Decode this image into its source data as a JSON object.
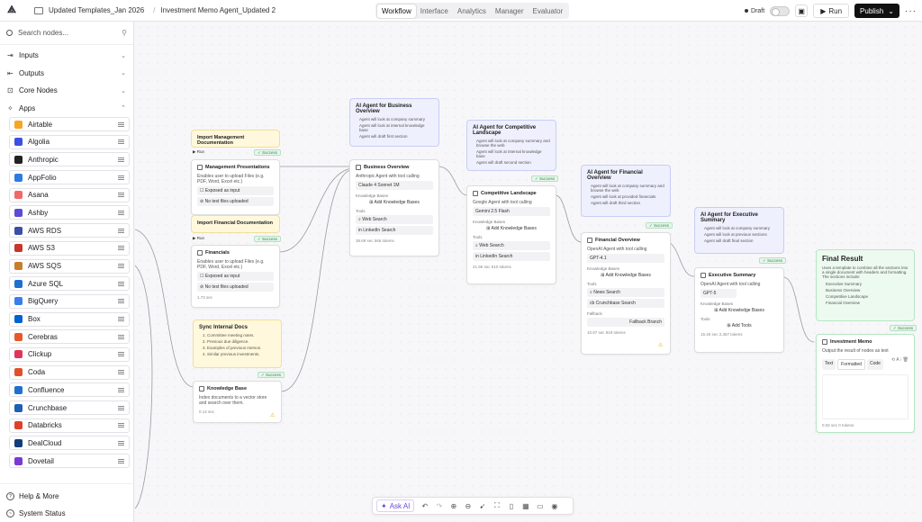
{
  "header": {
    "breadcrumb_1": "Updated Templates_Jan 2026",
    "breadcrumb_2": "Investment Memo Agent_Updated 2",
    "tabs": [
      "Workflow",
      "Interface",
      "Analytics",
      "Manager",
      "Evaluator"
    ],
    "active_tab": "Workflow",
    "draft_label": "Draft",
    "run_label": "Run",
    "publish_label": "Publish"
  },
  "sidebar": {
    "search_placeholder": "Search nodes...",
    "sections": [
      "Inputs",
      "Outputs",
      "Core Nodes",
      "Apps"
    ],
    "apps": [
      {
        "label": "Airtable",
        "color": "#f5a623"
      },
      {
        "label": "Algolia",
        "color": "#3c4fe0"
      },
      {
        "label": "Anthropic",
        "color": "#222222"
      },
      {
        "label": "AppFolio",
        "color": "#2d7be0"
      },
      {
        "label": "Asana",
        "color": "#f06a6a"
      },
      {
        "label": "Ashby",
        "color": "#5b4bd6"
      },
      {
        "label": "AWS RDS",
        "color": "#3b4ea8"
      },
      {
        "label": "AWS S3",
        "color": "#c7352b"
      },
      {
        "label": "AWS SQS",
        "color": "#c77d2b"
      },
      {
        "label": "Azure SQL",
        "color": "#1f6fd1"
      },
      {
        "label": "BigQuery",
        "color": "#3b7ded"
      },
      {
        "label": "Box",
        "color": "#0061d5"
      },
      {
        "label": "Cerebras",
        "color": "#e8572b"
      },
      {
        "label": "Clickup",
        "color": "#e0345a"
      },
      {
        "label": "Coda",
        "color": "#e0502b"
      },
      {
        "label": "Confluence",
        "color": "#1f6fd1"
      },
      {
        "label": "Crunchbase",
        "color": "#1f5fb6"
      },
      {
        "label": "Databricks",
        "color": "#e0402b"
      },
      {
        "label": "DealCloud",
        "color": "#123d7a"
      },
      {
        "label": "Dovetail",
        "color": "#7a3ad6"
      }
    ],
    "help_label": "Help & More",
    "status_label": "System Status"
  },
  "canvas": {
    "import_mgmt_title": "Import Management Documentation",
    "run_label": "Run",
    "success_label": "Success",
    "mgmt_node_title": "Management Presentations",
    "mgmt_node_desc": "Enables user to upload Files (e.g. PDF, Word, Excel etc.)",
    "exposed_input": "Exposed as input",
    "no_files": "No test files uploaded",
    "import_fin_title": "Import Financial Documentation",
    "fin_node_title": "Financials",
    "fin_node_desc": "Enables user to upload Files (e.g. PDF, Word, Excel etc.)",
    "fin_meta": "1.73 sec",
    "sync_title": "Sync Internal Docs",
    "sync_items": [
      "1.  Committee meeting notes.",
      "2.  Previous due diligence.",
      "3.  Examples of previous memos.",
      "4.  Similar previous investments."
    ],
    "kb_node_title": "Knowledge Base",
    "kb_node_desc": "Index documents to a vector store and search over them.",
    "kb_meta": "0.14 sec",
    "biz_sticky_title": "AI Agent for Business Overview",
    "biz_sticky_items": [
      "Agent will look at company summary",
      "Agent will look at internal knowledge base",
      "Agent will draft first section"
    ],
    "biz_node_title": "Business Overview",
    "biz_node_desc": "Anthropic Agent with tool calling",
    "biz_model": "Claude 4 Sonnet 1M",
    "kb_label": "Knowledge Bases",
    "add_kb": "Add Knowledge Bases",
    "tools_label": "Tools",
    "web_search": "Web Search",
    "linkedin_search": "LinkedIn Search",
    "biz_meta": "38.69 sec   566 tokens",
    "comp_sticky_title": "AI Agent for Competitive Landscape",
    "comp_sticky_items": [
      "Agent will look at company summary and browse the web",
      "Agent will look at internal knowledge base",
      "Agent will draft second section"
    ],
    "comp_node_title": "Competitive Landscape",
    "comp_node_desc": "Google Agent with tool calling",
    "comp_model": "Gemini 2.5 Flash",
    "comp_meta": "21.96 sec   510 tokens",
    "fin_sticky_title": "AI Agent for Financial Overview",
    "fin_sticky_items": [
      "Agent will look at company summary and browse the web",
      "Agent will look at provided financials",
      "Agent will draft third section"
    ],
    "finov_node_title": "Financial Overview",
    "finov_node_desc": "OpenAI Agent with tool calling",
    "finov_model": "GPT-4.1",
    "news_search": "News Search",
    "crunchbase_search": "Crunchbase Search",
    "fallback_label": "Fallback",
    "fallback_branch": "Fallback Branch",
    "finov_meta": "10.97 sec   819 tokens",
    "exec_sticky_title": "AI Agent for Executive Summary",
    "exec_sticky_items": [
      "Agent will look at company summary",
      "Agent will look at previous sections",
      "Agent will draft final section"
    ],
    "exec_node_title": "Executive Summary",
    "exec_node_desc": "OpenAI Agent with tool calling",
    "exec_model": "GPT-5",
    "add_tools": "Add Tools",
    "exec_meta": "15.40 sec   2,357 tokens",
    "final_title": "Final Result",
    "final_desc": "Uses a template to combine all the sections into a single document with headers and formatting. The sections include:",
    "final_items": [
      "Executive Summary",
      "Business Overview",
      "Competitive Landscape",
      "Financial Overview"
    ],
    "memo_node_title": "Investment Memo",
    "memo_node_desc": "Output the result of nodes as text",
    "memo_tabs": [
      "Text",
      "Formatted",
      "Code"
    ],
    "memo_meta": "0.02 sec   0 tokens"
  },
  "bottom_bar": {
    "ask_ai": "Ask AI"
  },
  "colors": {
    "accent": "#6b46d6",
    "success": "#2f8a46"
  }
}
